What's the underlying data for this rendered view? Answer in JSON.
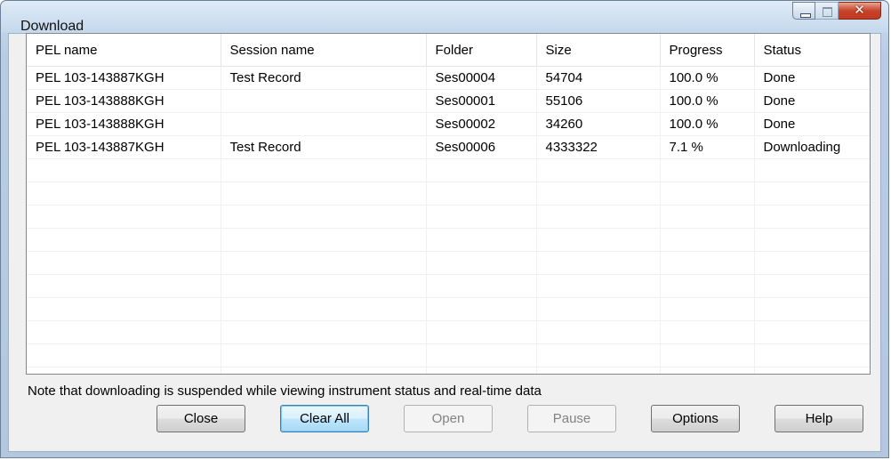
{
  "window": {
    "title": "Download"
  },
  "table": {
    "columns": [
      "PEL name",
      "Session name",
      "Folder",
      "Size",
      "Progress",
      "Status"
    ],
    "rows": [
      [
        "PEL 103-143887KGH",
        "Test Record",
        "Ses00004",
        "54704",
        "100.0 %",
        "Done"
      ],
      [
        "PEL 103-143888KGH",
        "",
        "Ses00001",
        "55106",
        "100.0 %",
        "Done"
      ],
      [
        "PEL 103-143888KGH",
        "",
        "Ses00002",
        "34260",
        "100.0 %",
        "Done"
      ],
      [
        "PEL 103-143887KGH",
        "Test Record",
        "Ses00006",
        "4333322",
        "7.1 %",
        "Downloading"
      ]
    ]
  },
  "note": "Note that downloading is suspended while viewing instrument status and real-time data",
  "buttons": {
    "close": "Close",
    "clear_all": "Clear All",
    "open": "Open",
    "pause": "Pause",
    "options": "Options",
    "help": "Help"
  }
}
